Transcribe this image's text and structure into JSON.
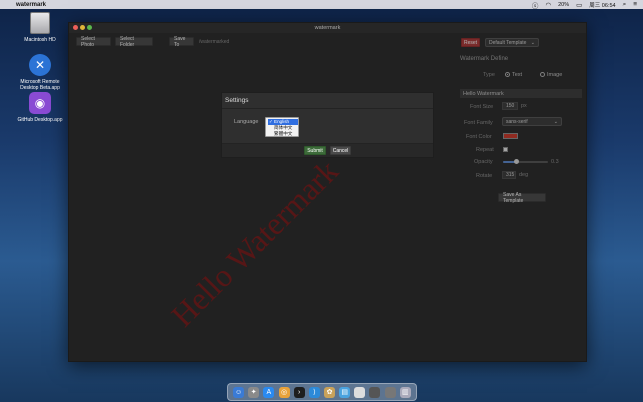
{
  "menubar": {
    "app_name": "watermark",
    "battery": "20%",
    "clock": "周三 06:54"
  },
  "desktop": [
    {
      "label": "Macintosh HD",
      "icon": "hard-drive-icon"
    },
    {
      "label": "Microsoft Remote Desktop Beta.app",
      "icon": "remote-desktop-icon"
    },
    {
      "label": "GitHub Desktop.app",
      "icon": "github-icon"
    }
  ],
  "window": {
    "title": "watermark",
    "toolbar": {
      "select_photo": "Select Photo",
      "select_folder": "Select Folder",
      "save_to": "Save To",
      "output_folder": "/watermarked"
    },
    "watermark_preview": "Hello Watermark",
    "right_panel": {
      "reset_label": "Reset",
      "template_select": "Default Template",
      "define_title": "Watermark Define",
      "type_label": "Type",
      "type_text": "Text",
      "type_image": "Image",
      "type_selected": "Text",
      "text_value": "Hello Watermark",
      "font_size_label": "Font Size",
      "font_size_value": "150",
      "font_size_unit": "px",
      "font_family_label": "Font Family",
      "font_family_value": "sans-serif",
      "font_color_label": "Font Color",
      "font_color_value": "#c0392b",
      "repeat_label": "Repeat",
      "opacity_label": "Opacity",
      "opacity_value": "0.3",
      "rotate_label": "Rotate",
      "rotate_value": "315",
      "rotate_unit": "deg",
      "save_template": "Save As Template"
    }
  },
  "settings_dialog": {
    "title": "Settings",
    "language_label": "Language",
    "options": [
      "English",
      "简体中文",
      "繁體中文"
    ],
    "selected": "English",
    "submit": "Submit",
    "cancel": "Cancel"
  },
  "colors": {
    "window_bg": "#2d2d2d",
    "submit_green": "#3d6b3a",
    "reset_red": "#a33a3a",
    "slider_blue": "#5b84c4",
    "watermark_red": "#8c1919"
  }
}
